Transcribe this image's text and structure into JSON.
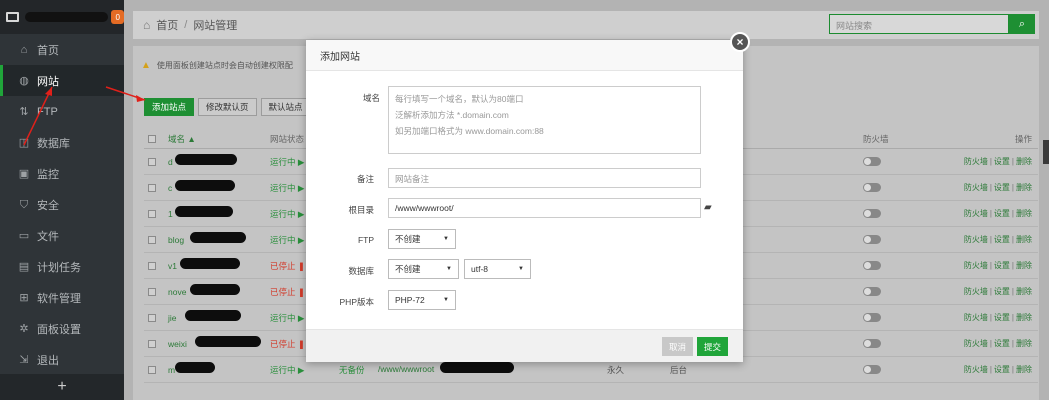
{
  "sidebar": {
    "badge": "0",
    "items": [
      {
        "label": "首页",
        "icon": "home-icon",
        "glyph": "⌂"
      },
      {
        "label": "网站",
        "icon": "globe-icon",
        "glyph": "◍"
      },
      {
        "label": "FTP",
        "icon": "ftp-icon",
        "glyph": "⇅"
      },
      {
        "label": "数据库",
        "icon": "database-icon",
        "glyph": "◫"
      },
      {
        "label": "监控",
        "icon": "monitor-icon",
        "glyph": "▣"
      },
      {
        "label": "安全",
        "icon": "shield-icon",
        "glyph": "⛉"
      },
      {
        "label": "文件",
        "icon": "folder-icon",
        "glyph": "▭"
      },
      {
        "label": "计划任务",
        "icon": "calendar-icon",
        "glyph": "▤"
      },
      {
        "label": "软件管理",
        "icon": "apps-icon",
        "glyph": "⊞"
      },
      {
        "label": "面板设置",
        "icon": "gear-icon",
        "glyph": "✲"
      },
      {
        "label": "退出",
        "icon": "logout-icon",
        "glyph": "⇲"
      }
    ],
    "plus": "+"
  },
  "breadcrumb": {
    "home": "首页",
    "sep": "/",
    "current": "网站管理"
  },
  "search": {
    "placeholder": "网站搜索"
  },
  "warning": "使用面板创建站点时会自动创建权限配",
  "toolbar": {
    "add": "添加站点",
    "modify_default": "修改默认页",
    "default_site": "默认站点"
  },
  "table": {
    "headers": {
      "name": "域名 ▲",
      "status": "网站状态",
      "firewall": "防火墙",
      "ops": "操作"
    },
    "rows": [
      {
        "name": "d",
        "status": "运行中 ▶",
        "state": "run",
        "rw": 62
      },
      {
        "name": "c",
        "status": "运行中 ▶",
        "state": "run",
        "rw": 60
      },
      {
        "name": "1",
        "status": "运行中 ▶",
        "state": "run",
        "rw": 58
      },
      {
        "name": "blog",
        "status": "运行中 ▶",
        "state": "run",
        "rw": 56
      },
      {
        "name": "v1",
        "status": "已停止 ❚❚",
        "state": "stop",
        "rw": 60
      },
      {
        "name": "nove",
        "status": "已停止 ❚❚",
        "state": "stop",
        "rw": 50
      },
      {
        "name": "jie",
        "status": "运行中 ▶",
        "state": "run",
        "rw": 56
      },
      {
        "name": "weixi",
        "status": "已停止 ❚❚",
        "state": "stop",
        "rw": 66
      },
      {
        "name": "m",
        "status": "运行中 ▶",
        "state": "run",
        "rw": 40
      }
    ],
    "ops": {
      "firewall": "防火墙",
      "settings": "设置",
      "delete": "删除",
      "bar": "|"
    },
    "last_row": {
      "backup": "无备份",
      "path": "/www/wwwroot",
      "expire": "永久",
      "note": "后台"
    }
  },
  "modal": {
    "title": "添加网站",
    "close": "×",
    "domain_label": "域名",
    "domain_hint_1": "每行填写一个域名，默认为80端口",
    "domain_hint_2": "泛解析添加方法 *.domain.com",
    "domain_hint_3": "如另加端口格式为 www.domain.com:88",
    "remark_label": "备注",
    "remark_placeholder": "网站备注",
    "root_label": "根目录",
    "root_value": "/www/wwwroot/",
    "ftp_label": "FTP",
    "ftp_value": "不创建",
    "db_label": "数据库",
    "db_value": "不创建",
    "charset_value": "utf-8",
    "php_label": "PHP版本",
    "php_value": "PHP-72",
    "cancel": "取消",
    "submit": "提交"
  }
}
